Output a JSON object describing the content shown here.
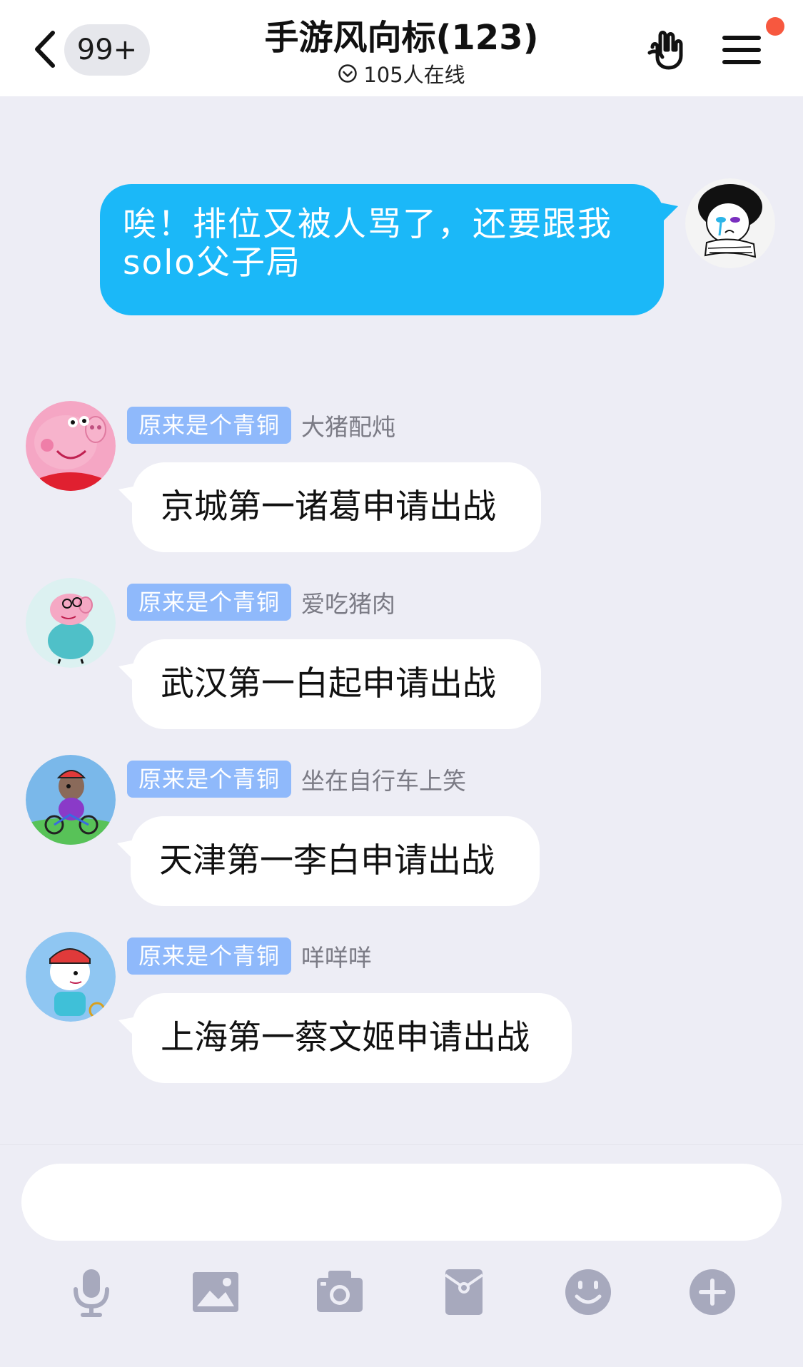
{
  "header": {
    "unread_count": "99+",
    "title": "手游风向标(123)",
    "online_text": "105人在线"
  },
  "outgoing_message": {
    "text_line1": "唉！排位又被人骂了，还要跟我",
    "text_line2": "solo父子局"
  },
  "messages": [
    {
      "level": "原来是个青铜",
      "nickname": "大猪配炖",
      "text": "京城第一诸葛申请出战"
    },
    {
      "level": "原来是个青铜",
      "nickname": "爱吃猪肉",
      "text": "武汉第一白起申请出战"
    },
    {
      "level": "原来是个青铜",
      "nickname": "坐在自行车上笑",
      "text": "天津第一李白申请出战"
    },
    {
      "level": "原来是个青铜",
      "nickname": "咩咩咩",
      "text": "上海第一蔡文姬申请出战"
    }
  ],
  "input": {
    "value": "",
    "placeholder": ""
  },
  "toolbar": [
    "microphone-icon",
    "image-icon",
    "camera-icon",
    "red-packet-icon",
    "emoji-icon",
    "plus-icon"
  ],
  "colors": {
    "outgoing_bubble": "#1bb8f8",
    "level_badge": "#8fb9fb",
    "background": "#ededf5",
    "notification_dot": "#f7583f"
  }
}
